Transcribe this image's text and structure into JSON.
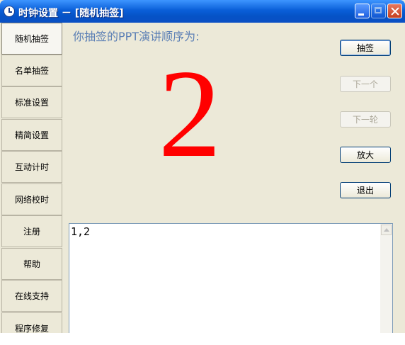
{
  "window": {
    "title": "时钟设置 － [随机抽签]",
    "icon": "clock-icon"
  },
  "sidebar": {
    "items": [
      {
        "label": "随机抽签",
        "active": true
      },
      {
        "label": "名单抽签",
        "active": false
      },
      {
        "label": "标准设置",
        "active": false
      },
      {
        "label": "精简设置",
        "active": false
      },
      {
        "label": "互动计时",
        "active": false
      },
      {
        "label": "网络校时",
        "active": false
      },
      {
        "label": "注册",
        "active": false
      },
      {
        "label": "帮助",
        "active": false
      },
      {
        "label": "在线支持",
        "active": false
      },
      {
        "label": "程序修复",
        "active": false
      }
    ]
  },
  "main": {
    "prompt": "你抽签的PPT演讲顺序为:",
    "current_number": "2",
    "number_color": "#ff0000",
    "history": "1,2"
  },
  "actions": {
    "draw": {
      "label": "抽签",
      "enabled": true
    },
    "next": {
      "label": "下一个",
      "enabled": false
    },
    "next_round": {
      "label": "下一轮",
      "enabled": false
    },
    "zoom": {
      "label": "放大",
      "enabled": true
    },
    "exit": {
      "label": "退出",
      "enabled": true
    }
  }
}
